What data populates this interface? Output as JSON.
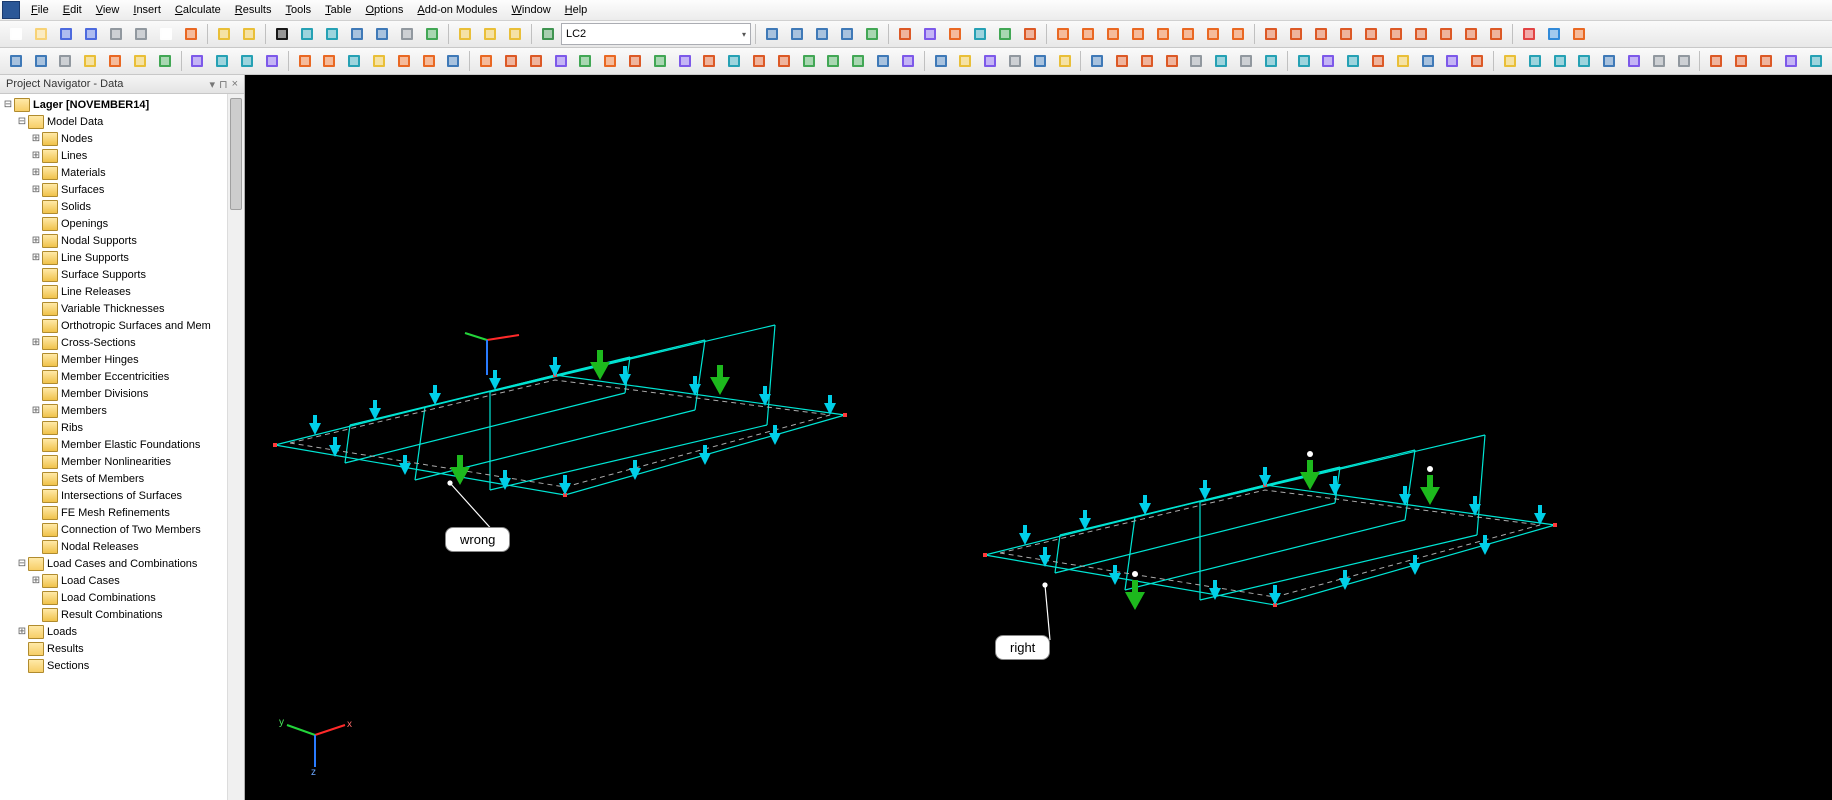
{
  "menu": {
    "items": [
      "File",
      "Edit",
      "View",
      "Insert",
      "Calculate",
      "Results",
      "Tools",
      "Table",
      "Options",
      "Add-on Modules",
      "Window",
      "Help"
    ]
  },
  "loadcase_combo": {
    "value": "LC2"
  },
  "navigator": {
    "title": "Project Navigator - Data",
    "root": {
      "label": "Lager [NOVEMBER14]"
    },
    "model_data": {
      "label": "Model Data",
      "children": [
        "Nodes",
        "Lines",
        "Materials",
        "Surfaces",
        "Solids",
        "Openings",
        "Nodal Supports",
        "Line Supports",
        "Surface Supports",
        "Line Releases",
        "Variable Thicknesses",
        "Orthotropic Surfaces and Mem",
        "Cross-Sections",
        "Member Hinges",
        "Member Eccentricities",
        "Member Divisions",
        "Members",
        "Ribs",
        "Member Elastic Foundations",
        "Member Nonlinearities",
        "Sets of Members",
        "Intersections of Surfaces",
        "FE Mesh Refinements",
        "Connection of Two Members",
        "Nodal Releases"
      ]
    },
    "load_cases": {
      "label": "Load Cases and Combinations",
      "children": [
        "Load Cases",
        "Load Combinations",
        "Result Combinations"
      ]
    },
    "loads": {
      "label": "Loads"
    },
    "results": {
      "label": "Results"
    },
    "sections": {
      "label": "Sections"
    }
  },
  "callouts": {
    "left": "wrong",
    "right": "right"
  },
  "axes": {
    "x": "x",
    "y": "y",
    "z": "z"
  },
  "toolbar_icons_row1": [
    "new-file",
    "open-file",
    "save-file",
    "save-all",
    "print",
    "print-preview",
    "page-setup",
    "export",
    "|",
    "undo",
    "redo",
    "|",
    "select-arrow",
    "select-window",
    "select-polygon",
    "zoom-window",
    "zoom-extents",
    "pan",
    "rotate-view",
    "|",
    "toggle-grid",
    "toggle-axes",
    "toggle-nav",
    "|",
    "globe-icon",
    "combo",
    "|",
    "nav-first",
    "nav-prev",
    "nav-next",
    "nav-last",
    "refresh",
    "|",
    "show-loads",
    "show-results",
    "results-colors",
    "results-mesh",
    "results-deform",
    "results-values",
    "|",
    "diagram-1",
    "diagram-2",
    "diagram-3",
    "diagram-4",
    "diagram-5",
    "diagram-6",
    "diagram-7",
    "diagram-8",
    "|",
    "tool-a",
    "tool-b",
    "tool-c",
    "tool-d",
    "tool-e",
    "tool-f",
    "tool-g",
    "tool-h",
    "tool-i",
    "tool-j",
    "|",
    "flag-red",
    "flag-blue",
    "pointer-info"
  ],
  "toolbar_icons_row2": [
    "new-node",
    "new-line",
    "new-member",
    "new-surface",
    "new-solid",
    "new-opening",
    "new-set",
    "|",
    "support-nodal",
    "support-line",
    "release-line",
    "hinge",
    "|",
    "load-node",
    "load-line",
    "load-surface",
    "load-member",
    "load-free",
    "load-temp",
    "load-gen",
    "|",
    "move-copy",
    "rotate",
    "mirror",
    "scale",
    "project",
    "intersect",
    "divide",
    "connect",
    "merge",
    "extend",
    "trim",
    "fillet",
    "offset",
    "convert",
    "reverse",
    "extrude",
    "renumber",
    "purge",
    "|",
    "mesh-gen",
    "mesh-refine",
    "mesh-settings",
    "calc-check",
    "calc-run",
    "calc-params",
    "|",
    "view-iso",
    "view-x",
    "view-y",
    "view-z",
    "view-persp",
    "walk",
    "work-plane",
    "section-view",
    "|",
    "snap",
    "ortho",
    "grid",
    "guides",
    "object-snap",
    "distance",
    "angle",
    "coords",
    "|",
    "render-wire",
    "render-solid",
    "render-shade",
    "render-trans",
    "color-by",
    "display-props",
    "visibility",
    "clip-plane",
    "|",
    "filter",
    "layers",
    "groups",
    "print-graphic",
    "help-context"
  ]
}
